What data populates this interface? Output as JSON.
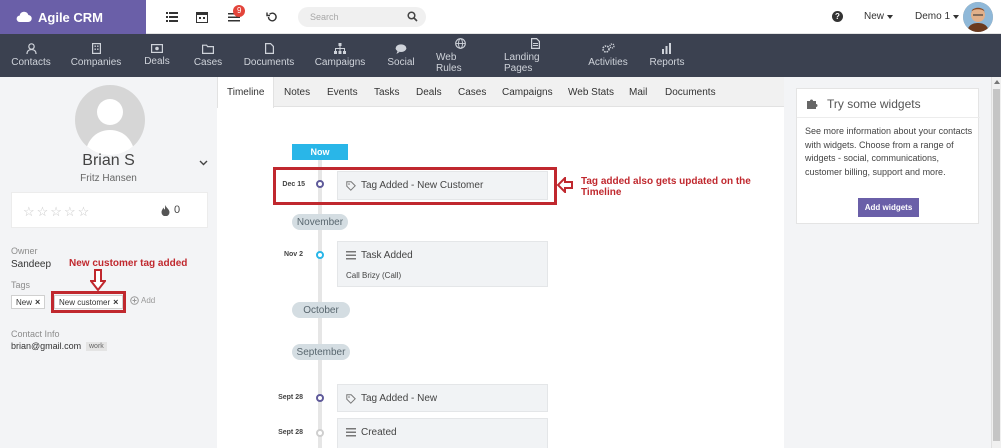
{
  "app": {
    "title": "Agile CRM"
  },
  "topbar": {
    "notification_count": "9",
    "search_placeholder": "Search",
    "new_label": "New",
    "user_label": "Demo 1"
  },
  "nav": [
    {
      "label": "Contacts",
      "icon": "user-icon"
    },
    {
      "label": "Companies",
      "icon": "building-icon"
    },
    {
      "label": "Deals",
      "icon": "money-icon"
    },
    {
      "label": "Cases",
      "icon": "folder-icon"
    },
    {
      "label": "Documents",
      "icon": "file-icon"
    },
    {
      "label": "Campaigns",
      "icon": "sitemap-icon"
    },
    {
      "label": "Social",
      "icon": "chat-icon"
    },
    {
      "label": "Web Rules",
      "icon": "globe-icon"
    },
    {
      "label": "Landing Pages",
      "icon": "page-icon"
    },
    {
      "label": "Activities",
      "icon": "gears-icon"
    },
    {
      "label": "Reports",
      "icon": "bar-chart-icon"
    }
  ],
  "contact": {
    "name": "Brian S",
    "company": "Fritz Hansen",
    "stars": "☆☆☆☆☆",
    "score": "0",
    "owner_label": "Owner",
    "owner": "Sandeep",
    "tags_label": "Tags",
    "tags": [
      {
        "label": "New",
        "remove": "×"
      },
      {
        "label": "New customer",
        "remove": "×"
      }
    ],
    "add_label": "Add",
    "contact_info_label": "Contact Info",
    "email": "brian@gmail.com",
    "email_type": "work"
  },
  "annotations": {
    "tag_note": "New customer tag added",
    "timeline_note": "Tag added also gets updated on the Timeline"
  },
  "tabs": [
    "Timeline",
    "Notes",
    "Events",
    "Tasks",
    "Deals",
    "Cases",
    "Campaigns",
    "Web Stats",
    "Mail",
    "Documents"
  ],
  "timeline": {
    "now_label": "Now",
    "months": [
      "November",
      "October",
      "September"
    ],
    "events": [
      {
        "date": "Dec 15",
        "title": "Tag Added - New Customer",
        "sub": ""
      },
      {
        "date": "Nov 2",
        "title": "Task Added",
        "sub": "Call Brizy (Call)"
      },
      {
        "date": "Sept 28",
        "title": "Tag Added - New",
        "sub": ""
      },
      {
        "date": "Sept 28",
        "title": "Created",
        "sub": ""
      }
    ]
  },
  "widgets": {
    "title": "Try some widgets",
    "text": "See more information about your contacts with widgets. Choose from a range of widgets - social, communications, customer billing, support and more.",
    "button": "Add widgets"
  },
  "colors": {
    "brand": "#6a5fa8",
    "nav_bg": "#3b4150",
    "accent_blue": "#29b6e8",
    "annotation_red": "#c0282e"
  }
}
